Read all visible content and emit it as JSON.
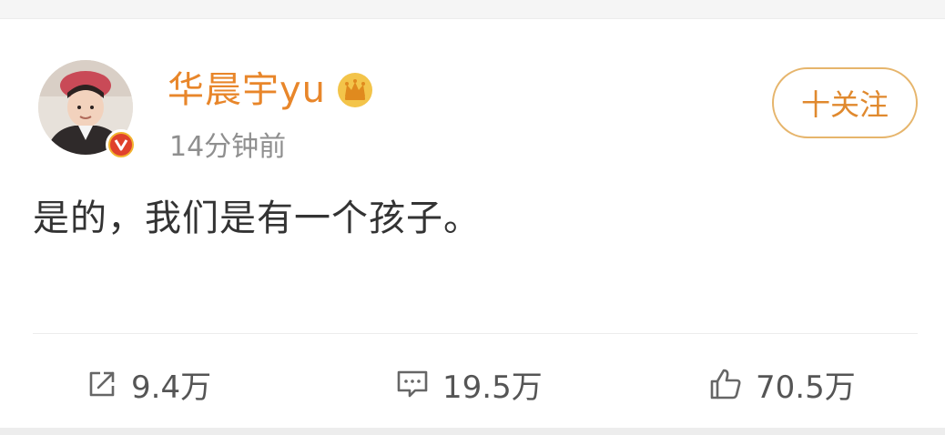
{
  "post": {
    "username": "华晨宇yu",
    "timestamp": "14分钟前",
    "follow_label": "十关注",
    "content": "是的，我们是有一个孩子。"
  },
  "actions": {
    "repost_count": "9.4万",
    "comment_count": "19.5万",
    "like_count": "70.5万"
  },
  "icons": {
    "avatar": "avatar-photo",
    "verified": "verified-v-badge-icon",
    "membership": "crown-icon",
    "repost": "repost-icon",
    "comment": "comment-icon",
    "like": "thumbs-up-icon"
  },
  "colors": {
    "username": "#e8862a",
    "follow_border": "#e6b56c",
    "follow_text": "#e0892e",
    "verified_badge": "#e0412b",
    "timestamp": "#8f8f8f",
    "content_text": "#333333",
    "action_text": "#555555"
  }
}
